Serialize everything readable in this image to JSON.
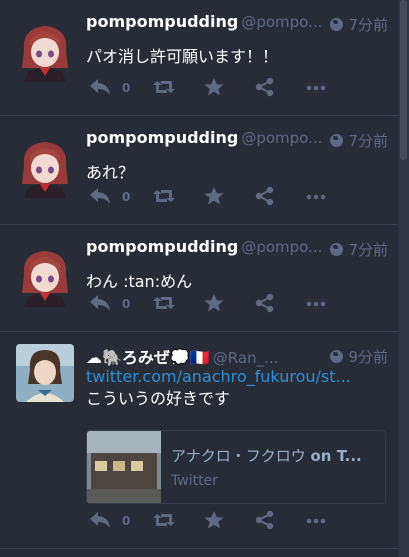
{
  "statuses": [
    {
      "display_name": "pompompudding",
      "account": "@pompo...",
      "time": "7分前",
      "content": "パオ消し許可願います！！",
      "reply_count": "0"
    },
    {
      "display_name": "pompompudding",
      "account": "@pompo...",
      "time": "7分前",
      "content": "あれ？",
      "reply_count": "0"
    },
    {
      "display_name": "pompompudding",
      "account": "@pompo...",
      "time": "7分前",
      "content": "わん :tan:めん",
      "reply_count": "0"
    },
    {
      "display_name": "☁🐘ろみぜ💭🇫🇷",
      "account": "@Ran_...",
      "time": "9分前",
      "link": "twitter.com/anachro_fukurou/st...",
      "content": "こういうの好きです",
      "reply_count": "0",
      "card": {
        "title": "アナクロ・フクロウ",
        "title_suffix": "on T...",
        "provider": "Twitter"
      }
    }
  ],
  "colors": {
    "background": "#282c37",
    "muted": "#606984",
    "link": "#2b90d9"
  }
}
